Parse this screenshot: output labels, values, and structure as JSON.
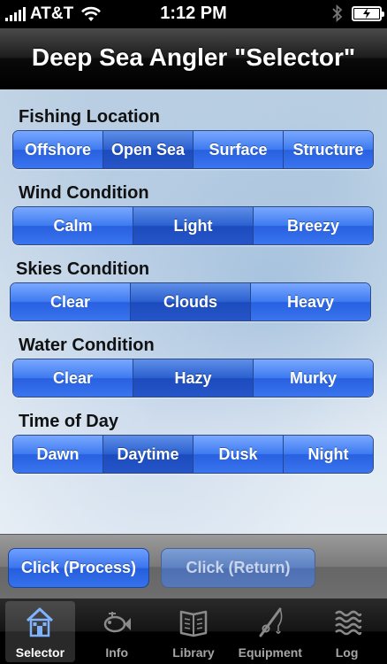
{
  "status_bar": {
    "carrier": "AT&T",
    "time": "1:12 PM"
  },
  "nav": {
    "title": "Deep Sea Angler \"Selector\""
  },
  "sections": [
    {
      "label": "Fishing Location",
      "options": [
        "Offshore",
        "Open Sea",
        "Surface",
        "Structure"
      ],
      "selected": "Open Sea"
    },
    {
      "label": "Wind Condition",
      "options": [
        "Calm",
        "Light",
        "Breezy"
      ],
      "selected": "Light"
    },
    {
      "label": "Skies Condition",
      "options": [
        "Clear",
        "Clouds",
        "Heavy"
      ],
      "selected": "Clouds"
    },
    {
      "label": "Water Condition",
      "options": [
        "Clear",
        "Hazy",
        "Murky"
      ],
      "selected": "Hazy"
    },
    {
      "label": "Time of Day",
      "options": [
        "Dawn",
        "Daytime",
        "Dusk",
        "Night"
      ],
      "selected": "Daytime"
    }
  ],
  "buttons": {
    "process": "Click (Process)",
    "return": "Click (Return)"
  },
  "tabs": [
    {
      "label": "Selector",
      "icon": "house-icon",
      "active": true
    },
    {
      "label": "Info",
      "icon": "fish-icon",
      "active": false
    },
    {
      "label": "Library",
      "icon": "book-icon",
      "active": false
    },
    {
      "label": "Equipment",
      "icon": "fishing-rod-icon",
      "active": false
    },
    {
      "label": "Log",
      "icon": "waves-icon",
      "active": false
    }
  ],
  "colors": {
    "segment_blue": "#3a74ee",
    "segment_selected": "#2555c8",
    "nav_black": "#000000"
  }
}
